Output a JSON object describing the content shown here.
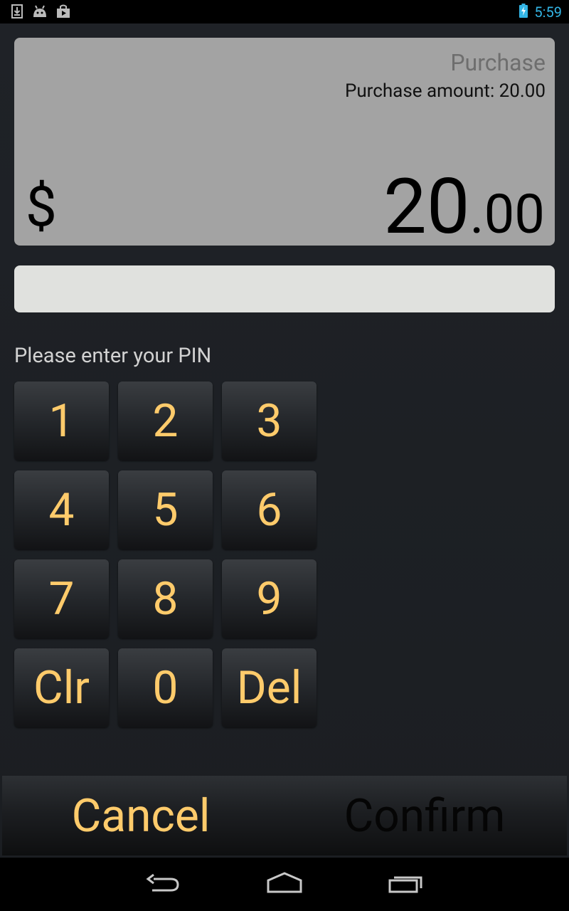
{
  "status_bar": {
    "time": "5:59",
    "accent_color": "#33b5e5",
    "icons": [
      "download-icon",
      "android-icon",
      "play-store-icon",
      "battery-charging-icon"
    ]
  },
  "transaction": {
    "type": "Purchase",
    "amount_line": "Purchase amount: 20.00",
    "currency_symbol": "$",
    "amount_integer": "20",
    "amount_fraction": ".00"
  },
  "pin": {
    "value": "",
    "prompt": "Please enter your PIN"
  },
  "keypad": {
    "k1": "1",
    "k2": "2",
    "k3": "3",
    "k4": "4",
    "k5": "5",
    "k6": "6",
    "k7": "7",
    "k8": "8",
    "k9": "9",
    "clear": "Clr",
    "k0": "0",
    "delete": "Del",
    "key_text_color": "#ffcb6b"
  },
  "actions": {
    "cancel": "Cancel",
    "confirm": "Confirm"
  },
  "nav_bar": {
    "icons": [
      "back-icon",
      "home-icon",
      "recent-apps-icon"
    ]
  }
}
